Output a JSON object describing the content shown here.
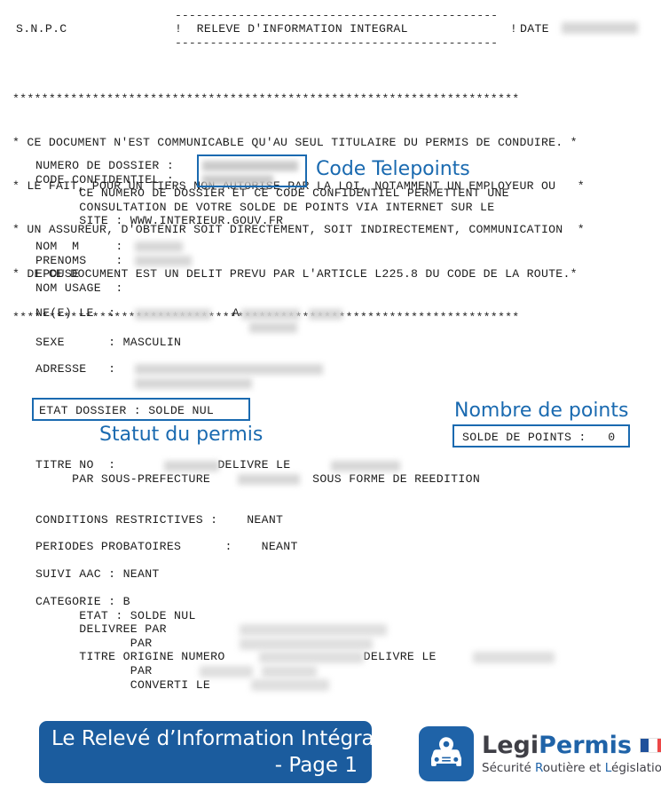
{
  "document": {
    "org": "S.N.P.C",
    "header": {
      "dashes": "----------------------------------------------",
      "title": "!  RELEVE D'INFORMATION INTEGRAL              !",
      "date_label": "DATE"
    },
    "warning": {
      "star_line": "**********************************************************************",
      "lines": [
        "* CE DOCUMENT N'EST COMMUNICABLE QU'AU SEUL TITULAIRE DU PERMIS DE CONDUIRE. *",
        "* LE FAIT, POUR UN TIERS NON AUTORISE PAR LA LOI, NOTAMMENT UN EMPLOYEUR OU   *",
        "* UN ASSUREUR, D'OBTENIR SOIT DIRECTEMENT, SOIT INDIRECTEMENT, COMMUNICATION  *",
        "* DE CE DOCUMENT EST UN DELIT PREVU PAR L'ARTICLE L225.8 DU CODE DE LA ROUTE.*"
      ]
    },
    "dossier_block": "NUMERO DE DOSSIER :\nCODE CONFIDENTIEL :\n      CE NUMERO DE DOSSIER ET CE CODE CONFIDENTIEL PERMETTENT UNE\n      CONSULTATION DE VOTRE SOLDE DE POINTS VIA INTERNET SUR LE\n      SITE : WWW.INTERIEUR.GOUV.FR",
    "identity_block": "NOM  M     :\nPRENOMS    :\nEPOUSE     :\nNOM USAGE  :",
    "naissance_line": "NE(E) LE  :                A",
    "sexe_line": "SEXE      : MASCULIN",
    "adresse_line": "ADRESSE   :",
    "titre_block": "TITRE NO  :              DELIVRE LE\n     PAR SOUS-PREFECTURE              SOUS FORME DE REEDITION",
    "conditions_line": "CONDITIONS RESTRICTIVES :    NEANT",
    "periodes_line": "PERIODES PROBATOIRES      :    NEANT",
    "suivi_line": "SUIVI AAC : NEANT",
    "categorie_block": "CATEGORIE : B\n      ETAT : SOLDE NUL\n      DELIVREE PAR\n             PAR\n      TITRE ORIGINE NUMERO                   DELIVRE LE\n             PAR\n             CONVERTI LE"
  },
  "annotations": {
    "accent_color": "#1a6ab0",
    "code_telepoints_label": "Code Telepoints",
    "statut_permis_label": "Statut du permis",
    "nombre_points_label": "Nombre de points",
    "etat_dossier_value": "ETAT DOSSIER : SOLDE NUL",
    "solde_points_value": "SOLDE DE POINTS :   0"
  },
  "footer": {
    "banner": {
      "line1": "Le Relevé d’Information Intégral",
      "line2": "- Page 1",
      "bg_color": "#1b5c9e"
    },
    "brand": {
      "name_part1": "Legi",
      "name_part2": "Permis",
      "tagline_a": "Sécurité ",
      "tagline_b": "R",
      "tagline_c": "outière et ",
      "tagline_d": "L",
      "tagline_e": "égislation",
      "color_primary": "#1f63a8"
    }
  }
}
